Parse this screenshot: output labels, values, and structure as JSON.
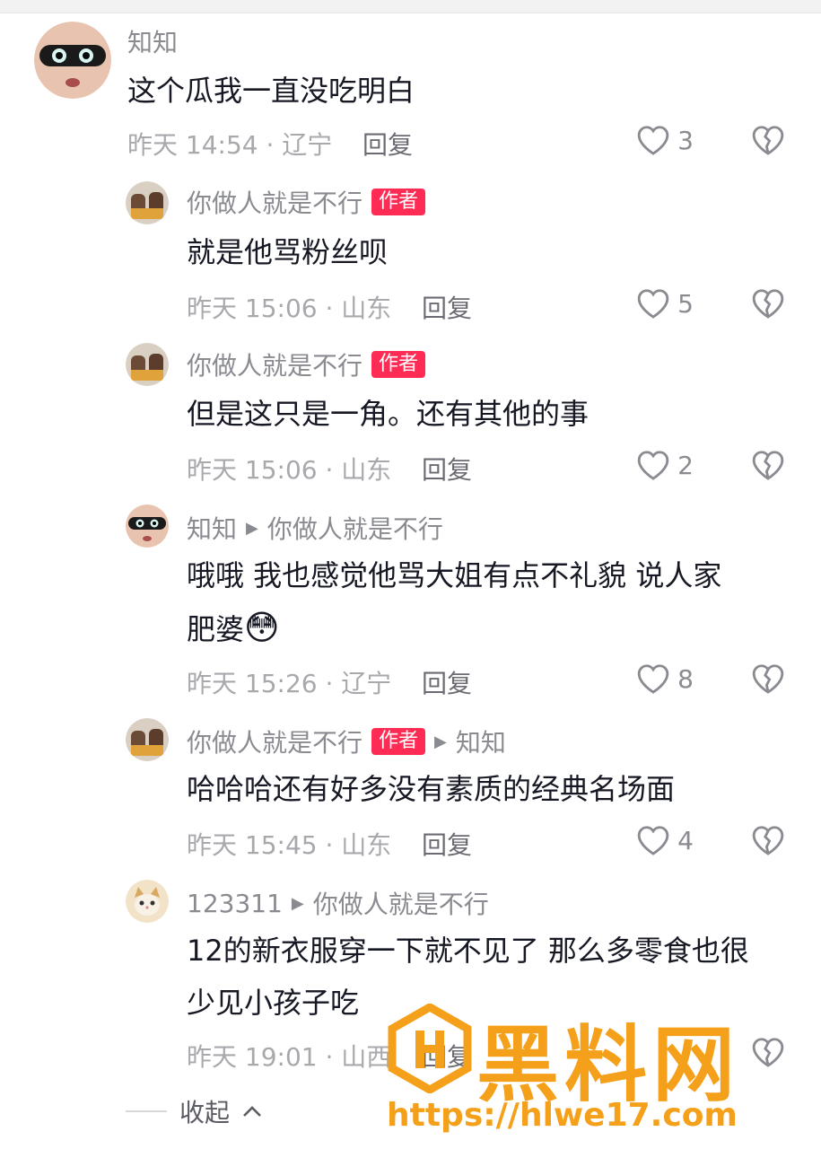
{
  "comments": [
    {
      "user": "知知",
      "text": [
        "这个瓜我一直没吃明白"
      ],
      "time": "昨天 14:54 · 辽宁",
      "reply": "回复",
      "likes": "3"
    },
    {
      "user": "你做人就是不行",
      "badge": "作者",
      "text": [
        "就是他骂粉丝呗"
      ],
      "time": "昨天 15:06 · 山东",
      "reply": "回复",
      "likes": "5"
    },
    {
      "user": "你做人就是不行",
      "badge": "作者",
      "text": [
        "但是这只是一角。还有其他的事"
      ],
      "time": "昨天 15:06 · 山东",
      "reply": "回复",
      "likes": "2"
    },
    {
      "user": "知知",
      "reply_to": "你做人就是不行",
      "text": [
        "哦哦 我也感觉他骂大姐有点不礼貌 说人家",
        "肥婆"
      ],
      "emoji": "😳",
      "time": "昨天 15:26 · 辽宁",
      "reply": "回复",
      "likes": "8"
    },
    {
      "user": "你做人就是不行",
      "badge": "作者",
      "reply_to": "知知",
      "text": [
        "哈哈哈还有好多没有素质的经典名场面"
      ],
      "time": "昨天 15:45 · 山东",
      "reply": "回复",
      "likes": "4"
    },
    {
      "user": "123311",
      "reply_to": "你做人就是不行",
      "text": [
        "12的新衣服穿一下就不见了 那么多零食也很",
        "少见小孩子吃"
      ],
      "time": "昨天 19:01 · 山西",
      "reply": "回复",
      "likes": ""
    }
  ],
  "collapse_label": "收起",
  "watermark": {
    "title": "黑料网",
    "url": "https://hlwe17.com"
  },
  "colors": {
    "badge": "#fe2c55",
    "secondary_text": "#8a8b91",
    "watermark": "#f5a01a"
  }
}
